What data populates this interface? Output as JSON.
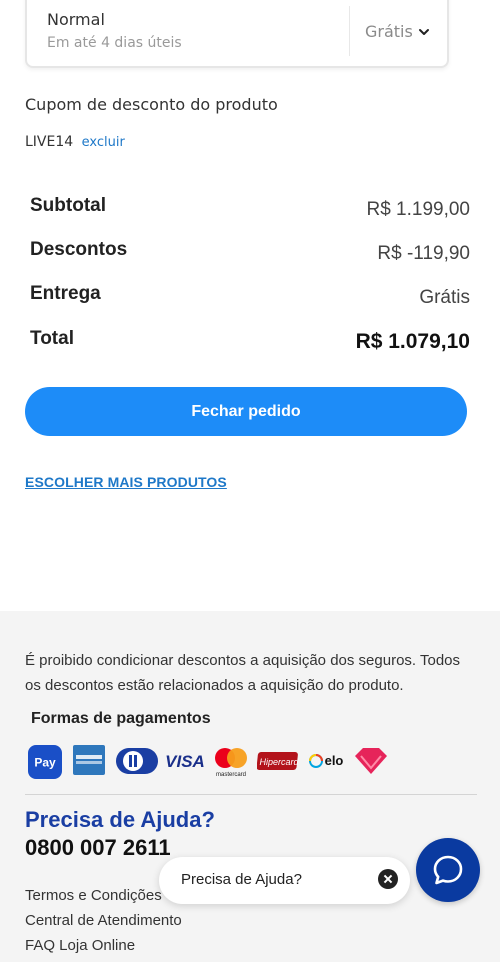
{
  "shipping": {
    "name": "Normal",
    "eta": "Em até 4 dias úteis",
    "price": "Grátis",
    "chevron_icon": "chevron-down-icon"
  },
  "coupon": {
    "title": "Cupom de desconto do produto",
    "code": "LIVE14",
    "remove_label": "excluir"
  },
  "summary": {
    "subtotal_label": "Subtotal",
    "subtotal_value": "R$ 1.199,00",
    "discounts_label": "Descontos",
    "discounts_value": "R$ -119,90",
    "delivery_label": "Entrega",
    "delivery_value": "Grátis",
    "total_label": "Total",
    "total_value": "R$ 1.079,10"
  },
  "checkout_button": "Fechar pedido",
  "more_products_link": "ESCOLHER MAIS PRODUTOS",
  "footer": {
    "disclaimer": "É proibido condicionar descontos a aquisição dos seguros. Todos os descontos estão relacionados a aquisição do produto.",
    "payments_title": "Formas de pagamentos",
    "payment_methods": [
      "Pay",
      "American Express",
      "Diners Club",
      "VISA",
      "mastercard",
      "Hipercard",
      "elo",
      "Vivo Pay"
    ],
    "help_title": "Precisa de Ajuda?",
    "help_phone": "0800 007 2611",
    "links": [
      "Termos e Condições",
      "Central de Atendimento",
      "FAQ Loja Online"
    ]
  },
  "help_bubble": {
    "text": "Precisa de Ajuda?",
    "close_icon": "close-icon"
  },
  "chat_button_icon": "chat-icon",
  "colors": {
    "primary_button": "#1d8cf8",
    "link": "#1e78c8",
    "help_title": "#1a3ea3",
    "chat_button": "#0a3aa0",
    "footer_bg": "#f4f4f4"
  }
}
